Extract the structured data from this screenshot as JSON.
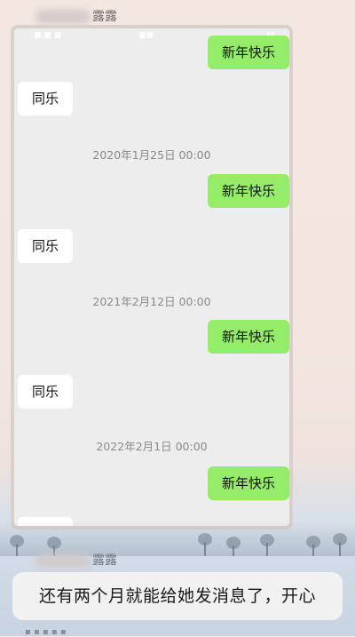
{
  "top_name_suffix": "露露",
  "bottom_name_suffix": "露露",
  "chat": {
    "messages": [
      {
        "kind": "mine",
        "text": "新年快乐"
      },
      {
        "kind": "theirs",
        "text": "同乐"
      },
      {
        "kind": "time",
        "text": "2020年1月25日 00:00"
      },
      {
        "kind": "mine",
        "text": "新年快乐"
      },
      {
        "kind": "theirs",
        "text": "同乐"
      },
      {
        "kind": "time",
        "text": "2021年2月12日 00:00"
      },
      {
        "kind": "mine",
        "text": "新年快乐"
      },
      {
        "kind": "theirs",
        "text": "同乐"
      },
      {
        "kind": "time",
        "text": "2022年2月1日 00:00"
      },
      {
        "kind": "mine",
        "text": "新年快乐"
      }
    ]
  },
  "caption": "还有两个月就能给她发消息了，开心"
}
